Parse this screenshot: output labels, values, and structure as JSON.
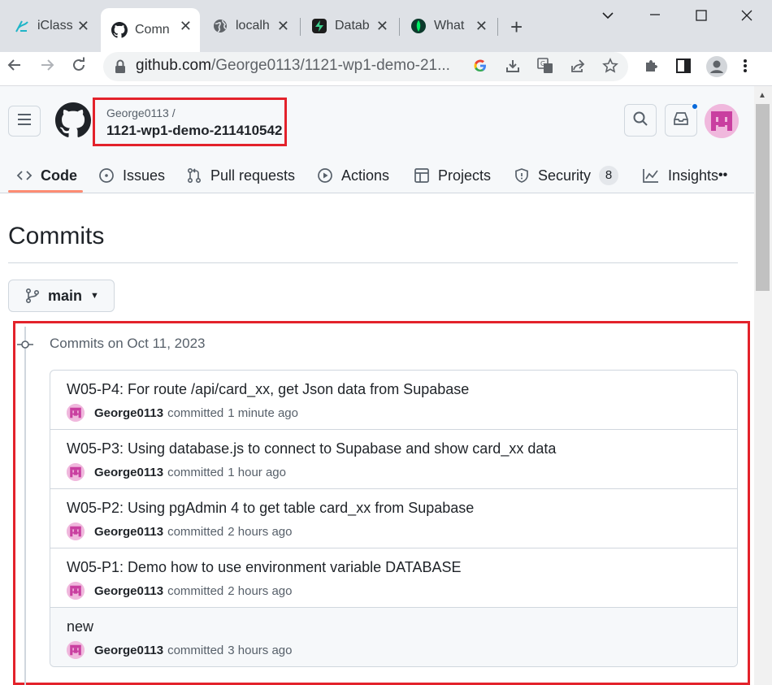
{
  "browser": {
    "tabs": [
      {
        "label": "iClass",
        "icon": "iclass-icon"
      },
      {
        "label": "Comn",
        "icon": "github-icon",
        "active": true
      },
      {
        "label": "localh",
        "icon": "globe-icon"
      },
      {
        "label": "Datab",
        "icon": "supabase-icon"
      },
      {
        "label": "What",
        "icon": "mongodb-leaf-icon"
      }
    ],
    "new_tab": "+",
    "url_host": "github.com",
    "url_path": "/George0113/1121-wp1-demo-21..."
  },
  "repo": {
    "owner": "George0113 /",
    "name": "1121-wp1-demo-211410542"
  },
  "nav": {
    "items": [
      {
        "label": "Code",
        "icon": "code-icon",
        "selected": true
      },
      {
        "label": "Issues",
        "icon": "issue-opened-icon"
      },
      {
        "label": "Pull requests",
        "icon": "git-pull-request-icon"
      },
      {
        "label": "Actions",
        "icon": "play-icon"
      },
      {
        "label": "Projects",
        "icon": "table-icon"
      },
      {
        "label": "Security",
        "icon": "shield-icon",
        "counter": "8"
      },
      {
        "label": "Insights",
        "icon": "graph-icon"
      }
    ],
    "more": "••"
  },
  "page": {
    "title": "Commits",
    "branch": "main"
  },
  "commits": {
    "group_date": "Commits on Oct 11, 2023",
    "items": [
      {
        "message": "W05-P4: For route /api/card_xx, get Json data from Supabase",
        "author": "George0113",
        "verb": "committed",
        "time": "1 minute ago"
      },
      {
        "message": "W05-P3: Using database.js to connect to Supabase and show card_xx data",
        "author": "George0113",
        "verb": "committed",
        "time": "1 hour ago"
      },
      {
        "message": "W05-P2: Using pgAdmin 4 to get table card_xx from Supabase",
        "author": "George0113",
        "verb": "committed",
        "time": "2 hours ago"
      },
      {
        "message": "W05-P1: Demo how to use environment variable DATABASE",
        "author": "George0113",
        "verb": "committed",
        "time": "2 hours ago"
      },
      {
        "message": "new",
        "author": "George0113",
        "verb": "committed",
        "time": "3 hours ago"
      }
    ]
  },
  "colors": {
    "highlight_border": "#e3222b",
    "tab_underline": "#fd8c73",
    "avatar_pink": "#f0b8dd",
    "notification_dot": "#0969da"
  }
}
